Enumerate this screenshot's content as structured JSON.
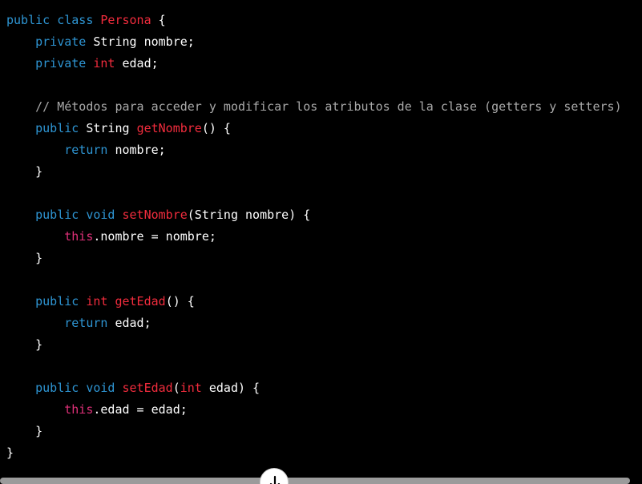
{
  "colors": {
    "background": "#000000",
    "keyword": "#2e95d3",
    "function": "#f22c3d",
    "this_keyword": "#df3079",
    "comment": "#a9a9a9",
    "plain": "#ffffff"
  },
  "code": {
    "lines": [
      [
        {
          "t": "kw",
          "v": "public"
        },
        {
          "t": "pl",
          "v": " "
        },
        {
          "t": "kw",
          "v": "class"
        },
        {
          "t": "pl",
          "v": " "
        },
        {
          "t": "fn",
          "v": "Persona"
        },
        {
          "t": "pl",
          "v": " {"
        }
      ],
      [
        {
          "t": "pl",
          "v": "    "
        },
        {
          "t": "kw",
          "v": "private"
        },
        {
          "t": "pl",
          "v": " String nombre;"
        }
      ],
      [
        {
          "t": "pl",
          "v": "    "
        },
        {
          "t": "kw",
          "v": "private"
        },
        {
          "t": "pl",
          "v": " "
        },
        {
          "t": "fn",
          "v": "int"
        },
        {
          "t": "pl",
          "v": " edad;"
        }
      ],
      [],
      [
        {
          "t": "pl",
          "v": "    "
        },
        {
          "t": "cm",
          "v": "// Métodos para acceder y modificar los atributos de la clase (getters y setters)"
        }
      ],
      [
        {
          "t": "pl",
          "v": "    "
        },
        {
          "t": "kw",
          "v": "public"
        },
        {
          "t": "pl",
          "v": " String "
        },
        {
          "t": "fn",
          "v": "getNombre"
        },
        {
          "t": "pl",
          "v": "() {"
        }
      ],
      [
        {
          "t": "pl",
          "v": "        "
        },
        {
          "t": "kw",
          "v": "return"
        },
        {
          "t": "pl",
          "v": " nombre;"
        }
      ],
      [
        {
          "t": "pl",
          "v": "    }"
        }
      ],
      [],
      [
        {
          "t": "pl",
          "v": "    "
        },
        {
          "t": "kw",
          "v": "public"
        },
        {
          "t": "pl",
          "v": " "
        },
        {
          "t": "kw",
          "v": "void"
        },
        {
          "t": "pl",
          "v": " "
        },
        {
          "t": "fn",
          "v": "setNombre"
        },
        {
          "t": "pl",
          "v": "(String nombre) {"
        }
      ],
      [
        {
          "t": "pl",
          "v": "        "
        },
        {
          "t": "this",
          "v": "this"
        },
        {
          "t": "pl",
          "v": ".nombre = nombre;"
        }
      ],
      [
        {
          "t": "pl",
          "v": "    }"
        }
      ],
      [],
      [
        {
          "t": "pl",
          "v": "    "
        },
        {
          "t": "kw",
          "v": "public"
        },
        {
          "t": "pl",
          "v": " "
        },
        {
          "t": "fn",
          "v": "int"
        },
        {
          "t": "pl",
          "v": " "
        },
        {
          "t": "fn",
          "v": "getEdad"
        },
        {
          "t": "pl",
          "v": "() {"
        }
      ],
      [
        {
          "t": "pl",
          "v": "        "
        },
        {
          "t": "kw",
          "v": "return"
        },
        {
          "t": "pl",
          "v": " edad;"
        }
      ],
      [
        {
          "t": "pl",
          "v": "    }"
        }
      ],
      [],
      [
        {
          "t": "pl",
          "v": "    "
        },
        {
          "t": "kw",
          "v": "public"
        },
        {
          "t": "pl",
          "v": " "
        },
        {
          "t": "kw",
          "v": "void"
        },
        {
          "t": "pl",
          "v": " "
        },
        {
          "t": "fn",
          "v": "setEdad"
        },
        {
          "t": "pl",
          "v": "("
        },
        {
          "t": "fn",
          "v": "int"
        },
        {
          "t": "pl",
          "v": " edad) {"
        }
      ],
      [
        {
          "t": "pl",
          "v": "        "
        },
        {
          "t": "this",
          "v": "this"
        },
        {
          "t": "pl",
          "v": ".edad = edad;"
        }
      ],
      [
        {
          "t": "pl",
          "v": "    }"
        }
      ],
      [
        {
          "t": "pl",
          "v": "}"
        }
      ]
    ]
  },
  "scroll_button": {
    "icon": "arrow-down-icon"
  }
}
